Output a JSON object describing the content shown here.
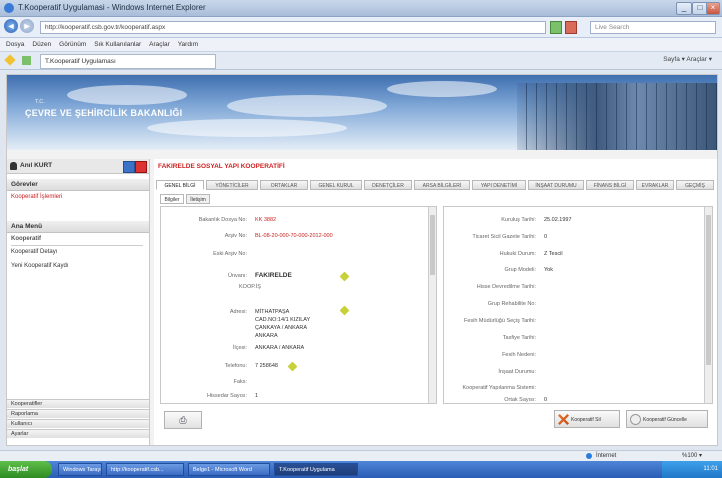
{
  "window": {
    "title": "T.Kooperatif Uygulamasi - Windows Internet Explorer"
  },
  "browser": {
    "url": "http://kooperatif.csb.gov.tr/kooperatif.aspx",
    "search_placeholder": "Live Search",
    "menu": [
      "Dosya",
      "Düzen",
      "Görünüm",
      "Sık Kullanılanlar",
      "Araçlar",
      "Yardım"
    ],
    "favorite_tab": "T.Kooperatif Uygulaması",
    "tools": "Sayfa ▾  Araçlar ▾"
  },
  "banner": {
    "ministry_sub": "T.C.",
    "ministry_name": "ÇEVRE VE ŞEHİRCİLİK BAKANLIĞI"
  },
  "left_panel": {
    "username": "Anıl KURT",
    "section1_title": "Görevler",
    "section1_item": "Kooperatif İşlemleri",
    "section2_title": "Ana Menü",
    "section2_sub": "Kooperatif",
    "menu_items": [
      "Kooperatif Detayı",
      "Yeni Kooperatif Kaydı"
    ],
    "bottom_items": [
      "Kooperatifler",
      "Raporlama",
      "Kullanıcı",
      "Ayarlar"
    ]
  },
  "content": {
    "title": "FAKIRELDE SOSYAL YAPI KOOPERATİFİ",
    "tabs": [
      "GENEL BİLGİ",
      "YÖNETİCİLER",
      "ORTAKLAR",
      "GENEL KURUL",
      "DENETÇİLER",
      "ARSA BİLGİLERİ",
      "YAPI DENETİMİ",
      "İNŞAAT DURUMU",
      "FİNANS BİLGİ",
      "EVRAKLAR",
      "GEÇMİŞ"
    ],
    "subtabs": [
      "Bilgiler",
      "İletişim"
    ],
    "left_fields": [
      {
        "label": "Bakanlık Dosya No:",
        "value": "KK 3882"
      },
      {
        "label": "Arşiv No:",
        "value": "BL-08-20-000-70-000-2012-000"
      },
      {
        "label": "Eski Arşiv No:",
        "value": ""
      },
      {
        "label": "Ünvanı:",
        "value": "FAKIRELDE"
      },
      {
        "label": "Adresi:",
        "value": "MİTHATPAŞA CAD.NO:14/1 KIZILAY ÇANKAYA"
      }
    ],
    "left_unvan_sub": "KOOP.İŞ",
    "address_lines": [
      "MİTHATPAŞA",
      "CAD.NO:14/1 KIZILAY",
      "ÇANKAYA / ANKARA",
      "ANKARA"
    ],
    "left_more": [
      {
        "label": "İlçesi:",
        "value": "ANKARA / ANKARA"
      },
      {
        "label": "Telefonu:",
        "value": "7 258648"
      },
      {
        "label": "Faks:",
        "value": ""
      },
      {
        "label": "Hissedar Sayısı:",
        "value": "1"
      }
    ],
    "right_fields": [
      {
        "label": "Kuruluş Tarihi:",
        "value": "25.02.1997"
      },
      {
        "label": "Ticaret Sicil Gazete Tarihi:",
        "value": "0"
      },
      {
        "label": "Hukuki Durum:",
        "value": "Z Tescil"
      },
      {
        "label": "Grup Modeli:",
        "value": "Yok"
      },
      {
        "label": "Hisse Devredilme Tarihi:",
        "value": ""
      },
      {
        "label": "Grup Rehabilite No:",
        "value": ""
      },
      {
        "label": "Fesih Müdürlüğü Seçiş Tarihi:",
        "value": ""
      },
      {
        "label": "Tasfiye Tarihi:",
        "value": ""
      },
      {
        "label": "Fesih Nedeni:",
        "value": ""
      },
      {
        "label": "İnşaat Durumu:",
        "value": ""
      },
      {
        "label": "Kooperatif Yapılanma Sistemi:",
        "value": ""
      },
      {
        "label": "Ortak Sayısı:",
        "value": "0"
      }
    ],
    "footer": {
      "print_icon": "printer-icon",
      "btn_delete": "Kooperatif Sil",
      "btn_update": "Kooperatif Güncelle"
    }
  },
  "statusbar": {
    "left": "İnternet",
    "zoom": "%100 ▾"
  },
  "taskbar": {
    "start": "başlat",
    "tasks": [
      "Windows Tarayıcı",
      "http://kooperatif.csb...",
      "Belge1 - Microsoft Word",
      "T.Kooperatif Uygulama"
    ],
    "clock": "11:01"
  }
}
